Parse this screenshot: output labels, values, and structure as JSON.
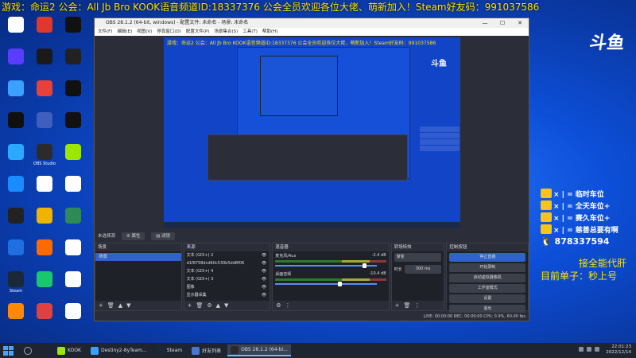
{
  "banner": {
    "text": "游戏：命运2   公会：All Jb Bro  KOOK语音频道ID:18337376  公会全员欢迎各位大佬、萌新加入！Steam好友码：991037586"
  },
  "desktop": {
    "icons": [
      {
        "label": "",
        "color": "#ffffff"
      },
      {
        "label": "",
        "color": "#e0392b"
      },
      {
        "label": "",
        "color": "#111111"
      },
      {
        "label": "",
        "color": "#5a3cff"
      },
      {
        "label": "",
        "color": "#1a1a1a"
      },
      {
        "label": "",
        "color": "#222222"
      },
      {
        "label": "",
        "color": "#3ba0ff"
      },
      {
        "label": "",
        "color": "#e8403a"
      },
      {
        "label": "",
        "color": "#111111"
      },
      {
        "label": "",
        "color": "#101010"
      },
      {
        "label": "",
        "color": "#3e5fbf"
      },
      {
        "label": "",
        "color": "#111111"
      },
      {
        "label": "",
        "color": "#2ba8ff"
      },
      {
        "label": "OBS Studio",
        "color": "#2b2b2b"
      },
      {
        "label": "",
        "color": "#9be700"
      },
      {
        "label": "",
        "color": "#1a8cff"
      },
      {
        "label": "",
        "color": "#ffffff"
      },
      {
        "label": "",
        "color": "#ffffff"
      },
      {
        "label": "",
        "color": "#222222"
      },
      {
        "label": "",
        "color": "#f0b400"
      },
      {
        "label": "",
        "color": "#2e8b57"
      },
      {
        "label": "",
        "color": "#1f6fe0"
      },
      {
        "label": "",
        "color": "#ff6a00"
      },
      {
        "label": "",
        "color": "#ffffff"
      },
      {
        "label": "Steam",
        "color": "#1b2838"
      },
      {
        "label": "",
        "color": "#18c86d"
      },
      {
        "label": "",
        "color": "#ffffff"
      },
      {
        "label": "",
        "color": "#ff8a00"
      },
      {
        "label": "",
        "color": "#e04040"
      },
      {
        "label": "",
        "color": "#ffffff"
      }
    ]
  },
  "logo": {
    "text": "斗鱼"
  },
  "overlay": {
    "rows": [
      {
        "text": "× | = 临时车位"
      },
      {
        "text": "× | = 全天车位+"
      },
      {
        "text": "× | = 赛久车位+"
      },
      {
        "text": "× | = 慈善总要有啊"
      }
    ],
    "qq": "878337594"
  },
  "side_text": {
    "line1": "接全能代肝",
    "line2": "目前单子：秒上号"
  },
  "obs": {
    "title": "OBS 28.1.2 (64-bit, windows) - 配置文件: 未命名 - 场景: 未命名",
    "menu": [
      "文件(F)",
      "编辑(E)",
      "视图(V)",
      "停靠窗口(D)",
      "配置文件(P)",
      "场景集合(S)",
      "工具(T)",
      "帮助(H)"
    ],
    "preview": {
      "banner": "游戏：命运2   公会：All Jb Bro  KOOK语音频道ID:18337376  公会全员欢迎各位大佬、萌新加入！Steam好友码：991037586",
      "logo": "斗鱼",
      "side1": "接全能代肝",
      "side2": "目前单子：秒上号",
      "qq": "878337594"
    },
    "source_bar": {
      "label": "未选择源",
      "props": "属性",
      "filters": "滤镜"
    },
    "scenes": {
      "title": "场景",
      "items": [
        "场景"
      ]
    },
    "sources": {
      "title": "来源",
      "items": [
        "文本 (GDI+) 2",
        "d1f8758dcd60c530b5dd8f06",
        "文本 (GDI+) 4",
        "文本 (GDI+) 3",
        "图像",
        "显示器采集"
      ]
    },
    "mixer": {
      "title": "混音器",
      "channels": [
        {
          "name": "麦克风/Aux",
          "db": "-2.4 dB",
          "level": 0.86
        },
        {
          "name": "桌面音频",
          "db": "-10.4 dB",
          "level": 0.62
        }
      ]
    },
    "transitions": {
      "title": "转场特效",
      "type": "渐变",
      "duration_label": "时长",
      "duration": "300 ms"
    },
    "controls": {
      "title": "控制按钮",
      "buttons": [
        "停止直播",
        "开始录制",
        "启动虚拟摄像机",
        "工作室模式",
        "设置",
        "退出"
      ]
    },
    "status": "LIVE: 00:00:00   REC: 00:00:00   CPU: 0.9%, 60.00 fps"
  },
  "taskbar": {
    "apps": [
      {
        "label": "KOOK",
        "color": "#9be700",
        "active": false
      },
      {
        "label": "Destiny2-8yTeam...",
        "color": "#3ba0ff",
        "active": false
      },
      {
        "label": "Steam",
        "color": "#1b2838",
        "active": false
      },
      {
        "label": "好友列表",
        "color": "#4a78d0",
        "active": false
      },
      {
        "label": "OBS 28.1.2 (64-bi...",
        "color": "#2b2b2b",
        "active": true
      }
    ],
    "time": "22:01:23",
    "date": "2022/12/14"
  }
}
